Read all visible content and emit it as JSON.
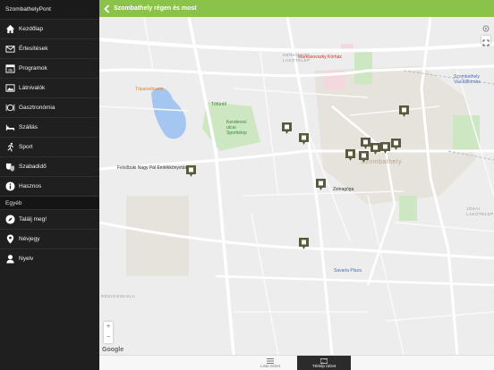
{
  "app": {
    "title": "SzombathelyPont"
  },
  "sidebar": {
    "items": [
      {
        "label": "Kezdőlap",
        "icon": "home-icon"
      },
      {
        "label": "Értesítések",
        "icon": "envelope-icon"
      },
      {
        "label": "Programok",
        "icon": "calendar-icon"
      },
      {
        "label": "Látnivalók",
        "icon": "gallery-icon"
      },
      {
        "label": "Gasztronómia",
        "icon": "cutlery-icon"
      },
      {
        "label": "Szállás",
        "icon": "bed-icon"
      },
      {
        "label": "Sport",
        "icon": "runner-icon"
      },
      {
        "label": "Szabadidő",
        "icon": "theater-masks-icon"
      },
      {
        "label": "Hasznos",
        "icon": "info-icon"
      }
    ],
    "section": "Egyéb",
    "extra_items": [
      {
        "label": "Találj meg!",
        "icon": "compass-icon"
      },
      {
        "label": "Névjegy",
        "icon": "location-pin-icon"
      },
      {
        "label": "Nyelv",
        "icon": "person-icon"
      }
    ]
  },
  "header": {
    "title": "Szombathely régen és most"
  },
  "map": {
    "labels": {
      "city": "Szombathely",
      "markusovszky": "Markusovszky Kórház",
      "toparadicsom": "Tóparadicsom",
      "tofurdo": "Tófürdő",
      "kendereske": "Kenderesi\nutcai\nSporttelep",
      "felsobudai": "Felsőbüki Nagy Pál Emlékkönyvtár",
      "zsinagoga": "Zsinagóga",
      "savaria": "Savaria Plaza",
      "vasutallomas": "Szombathely\nVasútállomás",
      "jokai": "JÓKAI\nLAKÓTELEP",
      "derkovits": "DERKOVITS\nLAKÓTELEP",
      "oladi": "RÉDIGOSKOLA"
    },
    "zoom_in": "+",
    "zoom_out": "−",
    "google": "Google"
  },
  "tabs": [
    {
      "label": "Lista nézet"
    },
    {
      "label": "Térkép nézet"
    }
  ],
  "colors": {
    "header": "#8bc34a",
    "sidebar": "#1f1f1f",
    "pin": "#5a5a3c"
  }
}
